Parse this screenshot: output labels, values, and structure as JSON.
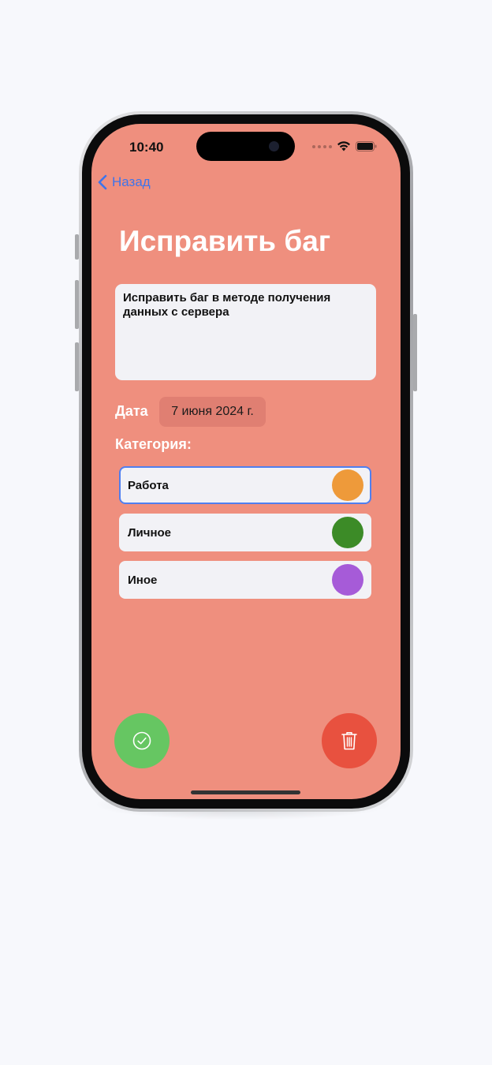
{
  "status": {
    "time": "10:40"
  },
  "nav": {
    "back_label": "Назад"
  },
  "page": {
    "title": "Исправить баг"
  },
  "note": {
    "text": "Исправить баг в методе получения данных с сервера"
  },
  "date": {
    "label": "Дата",
    "value": "7 июня 2024 г."
  },
  "category": {
    "label": "Категория:",
    "items": [
      {
        "name": "Работа",
        "color": "#ee9a3a",
        "selected": true
      },
      {
        "name": "Личное",
        "color": "#3c8b27",
        "selected": false
      },
      {
        "name": "Иное",
        "color": "#a65bd8",
        "selected": false
      }
    ]
  },
  "actions": {
    "complete_icon": "checkmark-circle-icon",
    "complete_color": "#66c662",
    "delete_icon": "trash-icon",
    "delete_color": "#e8513f"
  },
  "colors": {
    "background": "#ef8f7e",
    "accent": "#3f74ea",
    "selection_border": "#4f7ff0"
  }
}
